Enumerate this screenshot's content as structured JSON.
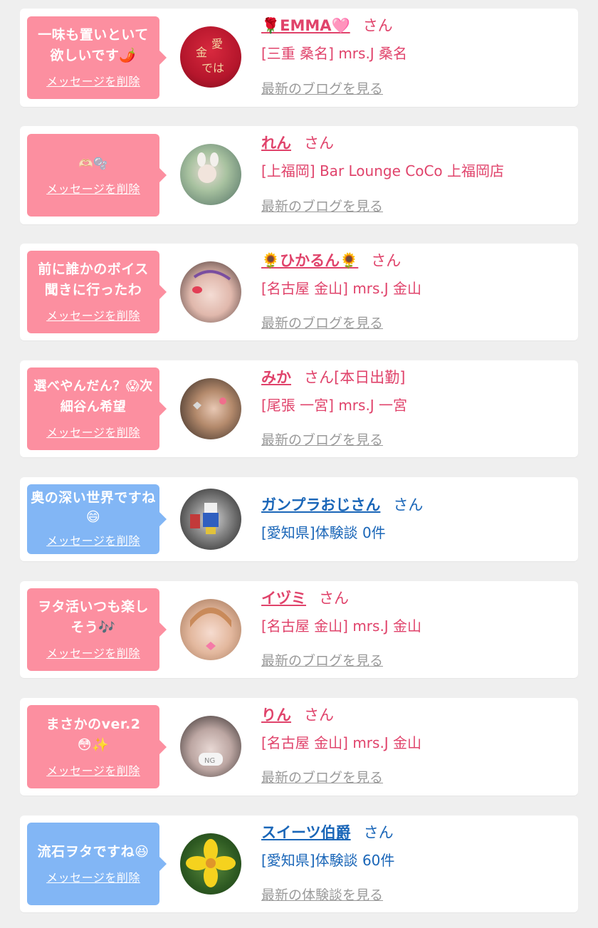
{
  "items": [
    {
      "message": "一味も置いといて欲しいです🌶️",
      "delete_label": "メッセージを削除",
      "name": "🌹EMMA🩷",
      "san": "さん",
      "shop": "[三重 桑名] mrs.J 桑名",
      "blog_link": "最新のブログを見る",
      "type": "pink"
    },
    {
      "message": "🫶🏻🫧",
      "delete_label": "メッセージを削除",
      "name": "れん",
      "san": "さん",
      "shop": "[上福岡] Bar Lounge CoCo 上福岡店",
      "blog_link": "最新のブログを見る",
      "type": "pink"
    },
    {
      "message": "前に誰かのボイス聞きに行ったわ",
      "delete_label": "メッセージを削除",
      "name": "🌻ひかるん🌻",
      "san": "さん",
      "shop": "[名古屋 金山] mrs.J 金山",
      "blog_link": "最新のブログを見る",
      "type": "pink"
    },
    {
      "message": "選べやんだん？😱次細谷ん希望",
      "delete_label": "メッセージを削除",
      "name": "みか",
      "san": "さん[本日出勤]",
      "shop": "[尾張 一宮] mrs.J 一宮",
      "blog_link": "最新のブログを見る",
      "type": "pink"
    },
    {
      "message": "奥の深い世界ですね😄",
      "delete_label": "メッセージを削除",
      "name": "ガンプラおじさん",
      "san": "さん",
      "shop": "[愛知県]体験談 0件",
      "blog_link": "",
      "type": "blue"
    },
    {
      "message": "ヲタ活いつも楽しそう🎶",
      "delete_label": "メッセージを削除",
      "name": "イヅミ",
      "san": "さん",
      "shop": "[名古屋 金山] mrs.J 金山",
      "blog_link": "最新のブログを見る",
      "type": "pink"
    },
    {
      "message": "まさかのver.2😳✨",
      "delete_label": "メッセージを削除",
      "name": "りん",
      "san": "さん",
      "shop": "[名古屋 金山] mrs.J 金山",
      "blog_link": "最新のブログを見る",
      "type": "pink"
    },
    {
      "message": "流石ヲタですね😆",
      "delete_label": "メッセージを削除",
      "name": "スイーツ伯爵",
      "san": "さん",
      "shop": "[愛知県]体験談 60件",
      "blog_link": "最新の体験談を見る",
      "type": "blue"
    }
  ],
  "colors": {
    "pink_bubble": "#fc8fa0",
    "blue_bubble": "#82b6f5",
    "pink_text": "#e0436b",
    "blue_text": "#1a66b8",
    "link_gray": "#9a9a9a"
  }
}
